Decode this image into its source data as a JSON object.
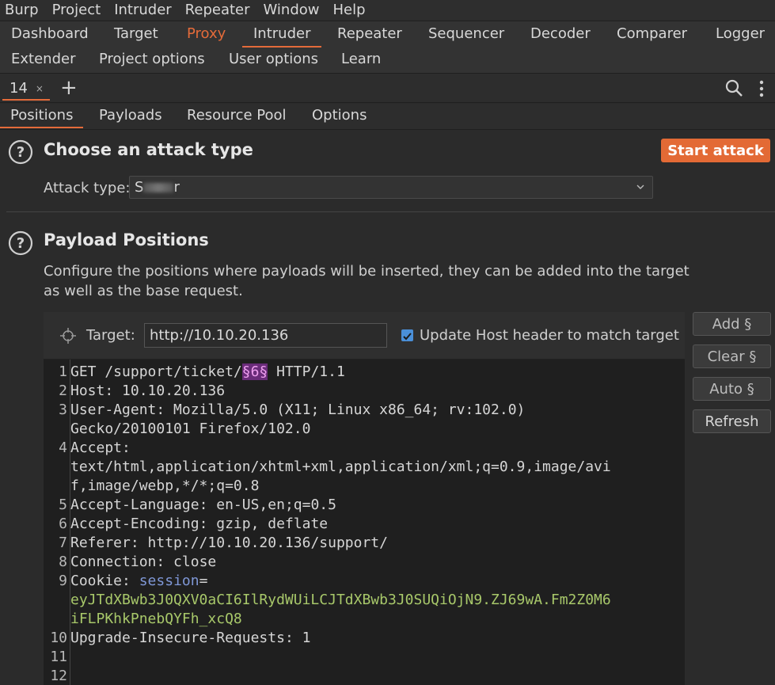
{
  "menu": [
    "Burp",
    "Project",
    "Intruder",
    "Repeater",
    "Window",
    "Help"
  ],
  "main_tabs_row1": [
    "Dashboard",
    "Target",
    "Proxy",
    "Intruder",
    "Repeater",
    "Sequencer",
    "Decoder",
    "Comparer",
    "Logger"
  ],
  "main_tabs_row2": [
    "Extender",
    "Project options",
    "User options",
    "Learn"
  ],
  "attack_tab": {
    "number": "14",
    "close": "×"
  },
  "add_tab": "+",
  "inner_tabs": [
    "Positions",
    "Payloads",
    "Resource Pool",
    "Options"
  ],
  "attack_type_section": {
    "title": "Choose an attack type",
    "start_button": "Start attack",
    "label": "Attack type:",
    "value_prefix": "S",
    "value_suffix": "r"
  },
  "payload_positions": {
    "title": "Payload Positions",
    "description": "Configure the positions where payloads will be inserted, they can be added into the target as well as the base request."
  },
  "target": {
    "label": "Target:",
    "value": "http://10.10.20.136",
    "update_host_label": "Update Host header to match target"
  },
  "side_buttons": [
    "Add §",
    "Clear §",
    "Auto §",
    "Refresh"
  ],
  "request_lines": {
    "l1": {
      "method": "GET /support/ticket/",
      "marker": "§6§",
      "rest": " HTTP/1.1"
    },
    "l2": {
      "name": "Host",
      "value": " 10.10.20.136"
    },
    "l3": {
      "name": "User-Agent",
      "value": " Mozilla/5.0 (X11; Linux x86_64; rv:102.0)",
      "wrap": "Gecko/20100101 Firefox/102.0"
    },
    "l4": {
      "name": "Accept",
      "wrap1": "text/html,application/xhtml+xml,application/xml;q=0.9,image/avi",
      "wrap2": "f,image/webp,*/*;q=0.8"
    },
    "l5": {
      "name": "Accept-Language",
      "value": " en-US,en;q=0.5"
    },
    "l6": {
      "name": "Accept-Encoding",
      "value": " gzip, deflate"
    },
    "l7": {
      "name": "Referer",
      "value": " http://10.10.20.136/support/"
    },
    "l8": {
      "name": "Connection",
      "value": " close"
    },
    "l9": {
      "name": "Cookie",
      "cookie_name": "session",
      "wrap1": "eyJTdXBwb3J0QXV0aCI6IlRydWUiLCJTdXBwb3J0SUQiOjN9.ZJ69wA.Fm2Z0M6",
      "wrap2": "iFLPKhkPnebQYFh_xcQ8"
    },
    "l10": {
      "name": "Upgrade-Insecure-Requests",
      "value": " 1"
    }
  },
  "line_numbers": [
    "1",
    "2",
    "3",
    "4",
    "5",
    "6",
    "7",
    "8",
    "9",
    "10",
    "11",
    "12"
  ],
  "colors": {
    "accent": "#e36a35",
    "marker_bg": "#6a2c7a",
    "cookie_value": "#a8c86a",
    "cookie_name": "#7f97d6"
  }
}
